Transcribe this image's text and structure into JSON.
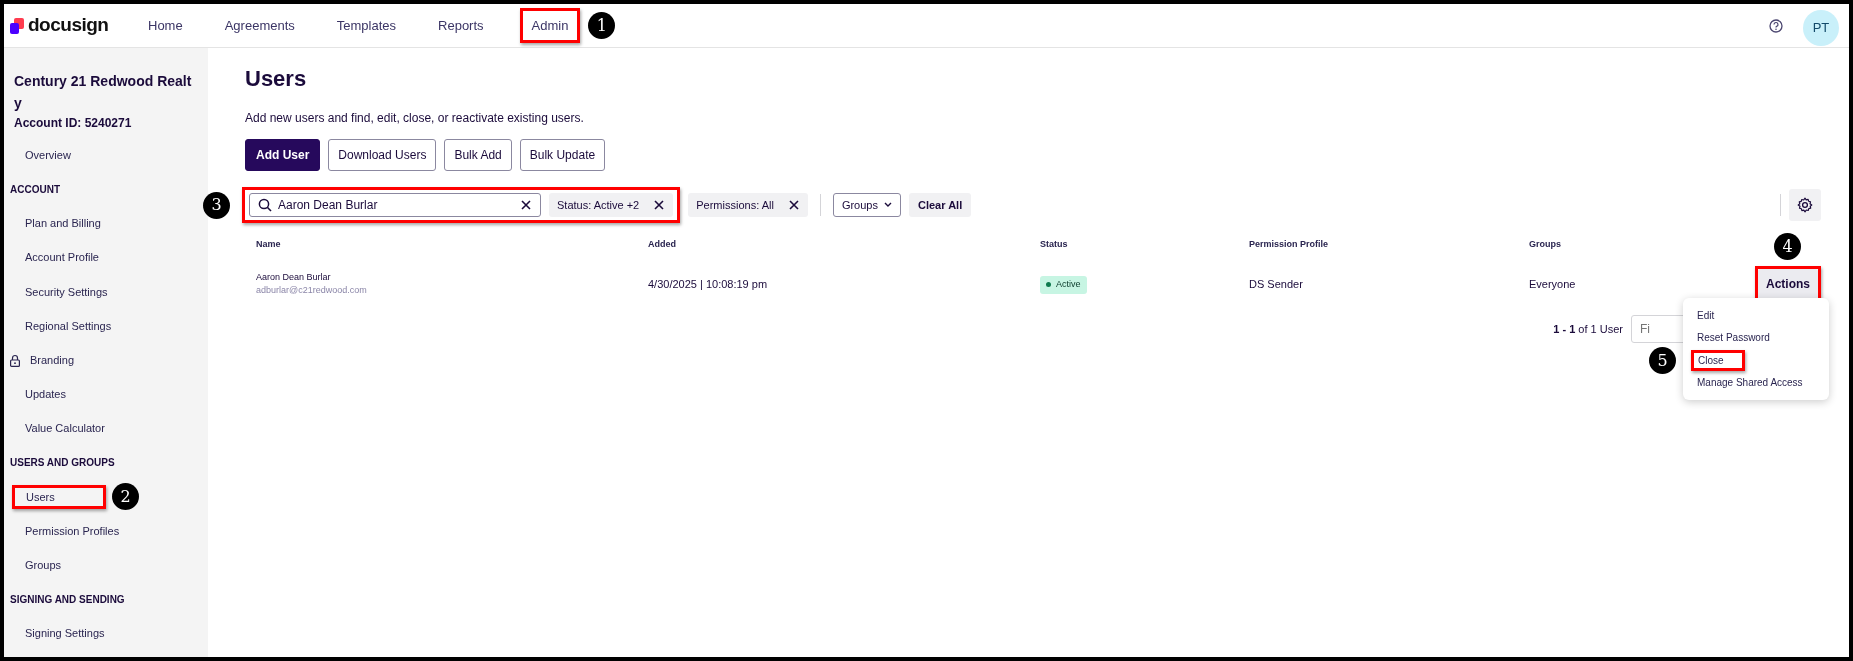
{
  "nav": {
    "logo": "docusign",
    "items": [
      {
        "label": "Home"
      },
      {
        "label": "Agreements"
      },
      {
        "label": "Templates"
      },
      {
        "label": "Reports"
      },
      {
        "label": "Admin",
        "highlighted": true,
        "marker": "1"
      }
    ],
    "avatar": "PT"
  },
  "sidebar": {
    "account_name": "Century 21 Redwood Realty",
    "account_id": "Account ID: 5240271",
    "items": [
      {
        "kind": "link",
        "label": "Overview"
      },
      {
        "kind": "heading",
        "label": "ACCOUNT"
      },
      {
        "kind": "link",
        "label": "Plan and Billing"
      },
      {
        "kind": "link",
        "label": "Account Profile"
      },
      {
        "kind": "link",
        "label": "Security Settings"
      },
      {
        "kind": "link",
        "label": "Regional Settings"
      },
      {
        "kind": "link",
        "label": "Branding",
        "locked": true
      },
      {
        "kind": "link",
        "label": "Updates"
      },
      {
        "kind": "link",
        "label": "Value Calculator"
      },
      {
        "kind": "heading",
        "label": "USERS AND GROUPS"
      },
      {
        "kind": "link",
        "label": "Users",
        "highlighted": true,
        "marker": "2"
      },
      {
        "kind": "link",
        "label": "Permission Profiles"
      },
      {
        "kind": "link",
        "label": "Groups"
      },
      {
        "kind": "heading",
        "label": "SIGNING AND SENDING"
      },
      {
        "kind": "link",
        "label": "Signing Settings"
      }
    ]
  },
  "page": {
    "title": "Users",
    "description": "Add new users and find, edit, close, or reactivate existing users.",
    "buttons": [
      {
        "label": "Add User",
        "kind": "primary"
      },
      {
        "label": "Download Users",
        "kind": "outline"
      },
      {
        "label": "Bulk Add",
        "kind": "outline"
      },
      {
        "label": "Bulk Update",
        "kind": "outline"
      }
    ]
  },
  "filters": {
    "search": {
      "value": "Aaron Dean Burlar",
      "highlighted": true,
      "marker": "3"
    },
    "items": [
      {
        "kind": "chip",
        "label": "Status: Active +2",
        "highlighted": true
      },
      {
        "kind": "chip",
        "label": "Permissions: All"
      },
      {
        "kind": "dropdown",
        "label": "Groups"
      },
      {
        "kind": "button",
        "label": "Clear All"
      }
    ]
  },
  "table": {
    "columns": [
      "Name",
      "Added",
      "Status",
      "Permission Profile",
      "Groups"
    ],
    "rows": [
      {
        "name": "Aaron Dean Burlar",
        "email": "adburlar@c21redwood.com",
        "added": "4/30/2025 | 10:08:19 pm",
        "status": {
          "label": "Active",
          "kind": "active"
        },
        "profile": "DS Sender",
        "groups": "Everyone",
        "action": {
          "label": "Actions",
          "highlighted": true,
          "marker": "4"
        }
      }
    ]
  },
  "pagination": {
    "range": "1 - 1",
    "summary": "of 1 User",
    "placeholder": "Fi"
  },
  "actions_menu": {
    "items": [
      {
        "label": "Edit"
      },
      {
        "label": "Reset Password"
      },
      {
        "label": "Close",
        "highlighted": true,
        "marker": "5"
      },
      {
        "label": "Manage Shared Access"
      }
    ]
  }
}
